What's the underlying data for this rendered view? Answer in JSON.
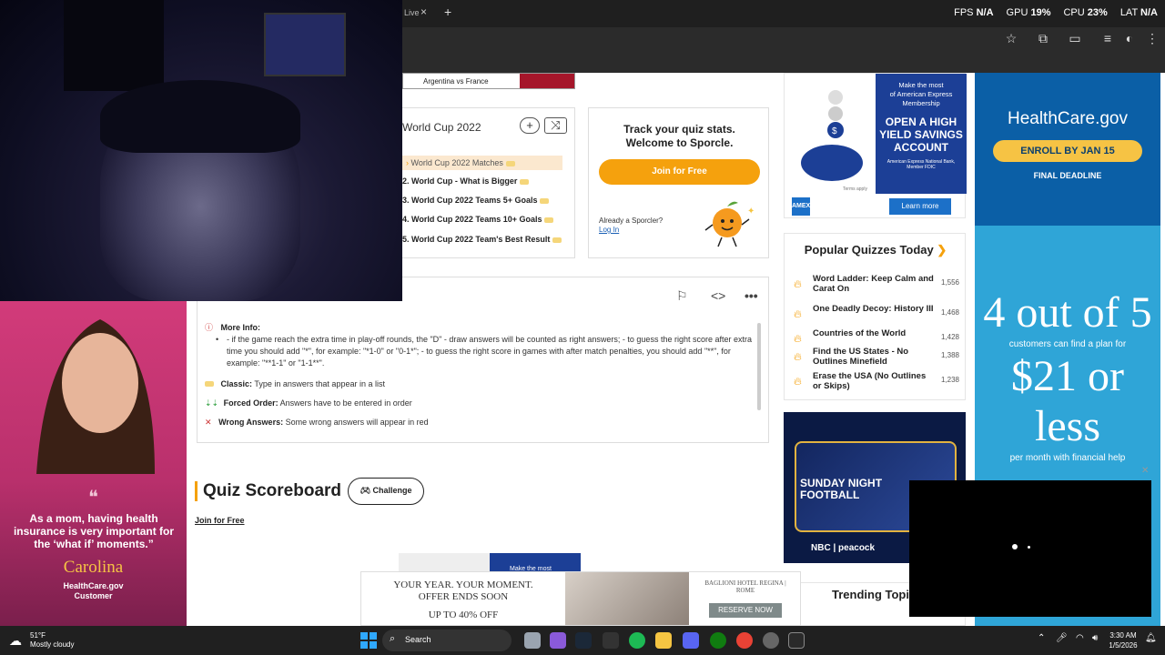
{
  "browser": {
    "tab_text": "Live",
    "new_tab_symbol": "+",
    "perf": {
      "fps_label": "FPS",
      "fps_value": "N/A",
      "gpu_label": "GPU",
      "gpu_value": "19",
      "cpu_label": "CPU",
      "cpu_value": "23",
      "lat_label": "LAT",
      "lat_value": "N/A"
    },
    "icons": [
      "star-icon",
      "extensions-icon",
      "split-view-icon",
      "reading-list-icon",
      "profile-icon",
      "menu-icon"
    ]
  },
  "quiz": {
    "match_label": "Argentina vs France",
    "related": {
      "title": "World Cup 2022",
      "items": [
        "World Cup 2022 Matches",
        "2. World Cup - What is Bigger",
        "3. World Cup 2022 Teams 5+ Goals",
        "4. World Cup 2022 Teams 10+ Goals",
        "5. World Cup 2022 Team's Best Result"
      ]
    },
    "track": {
      "title_line1": "Track your quiz stats.",
      "title_line2": "Welcome to Sporcle.",
      "join_button": "Join for Free",
      "already_text": "Already a Sporcler?",
      "login_link": "Log In"
    },
    "info": {
      "more_info_label": "More Info:",
      "more_info_text": "- if the game reach the extra time in play-off rounds, the \"D\" - draw answers will be counted as right answers; - to guess the right score after extra time you should add \"*\", for example: \"*1-0\" or \"0-1*\"; - to guess the right score in games with after match penalties, you should add \"**\", for example: \"**1-1\" or \"1-1**\".",
      "classic_label": "Classic:",
      "classic_text": "Type in answers that appear in a list",
      "forced_label": "Forced Order:",
      "forced_text": "Answers have to be entered in order",
      "wrong_label": "Wrong Answers:",
      "wrong_text": "Some wrong answers will appear in red"
    },
    "scoreboard": {
      "title": "Quiz Scoreboard",
      "challenge_button": "Challenge",
      "join_link": "Join for Free"
    }
  },
  "sidebar": {
    "amex_ad": {
      "line1": "Make the most",
      "line2": "of American Express",
      "line3": "Membership",
      "headline": "OPEN A HIGH YIELD SAVINGS ACCOUNT",
      "fine_print": "American Express National Bank, Member FDIC",
      "cta": "Learn more",
      "terms": "Terms apply"
    },
    "popular": {
      "title": "Popular Quizzes Today",
      "items": [
        {
          "name": "Word Ladder: Keep Calm and Carat On",
          "count": "1,556"
        },
        {
          "name": "One Deadly Decoy: History III",
          "count": "1,468"
        },
        {
          "name": "Countries of the World",
          "count": "1,428"
        },
        {
          "name": "Find the US States - No Outlines Minefield",
          "count": "1,388"
        },
        {
          "name": "Erase the USA (No Outlines or Skips)",
          "count": "1,238"
        }
      ]
    },
    "nfl_ad": {
      "title_line1": "SUNDAY NIGHT",
      "title_line2": "FOOTBALL",
      "networks": "NBC | peacock"
    },
    "trending_title": "Trending Topic"
  },
  "hc_ads": {
    "top_brand": "HealthCare.gov",
    "top_cta": "ENROLL BY JAN 15",
    "top_sub": "FINAL DEADLINE",
    "main_line1": "4 out of 5",
    "main_line2": "customers can find a plan for",
    "main_price": "$21 or less",
    "main_line3": "per month with financial help",
    "video_quote": "As a mom, having health insurance is very important for the ‘what if’ moments.”",
    "video_name": "Carolina",
    "video_role1": "HealthCare.gov",
    "video_role2": "Customer"
  },
  "hotel_ad": {
    "line1": "YOUR YEAR. YOUR MOMENT.",
    "line2": "OFFER ENDS SOON",
    "line3": "UP TO 40% OFF",
    "brand": "BAGLIONI HOTEL REGINA | ROME",
    "cta": "RESERVE NOW",
    "small_text": "Make the most"
  },
  "taskbar": {
    "weather_temp": "51°F",
    "weather_desc": "Mostly cloudy",
    "search_label": "Search",
    "time": "3:30 AM",
    "date": "1/5/2026"
  },
  "colors": {
    "sporcle_orange": "#f5a10d",
    "amex_blue": "#1c3f96",
    "hc_dark": "#0b5fa6",
    "hc_light": "#2fa5d7",
    "hc_yellow": "#f6c344"
  }
}
